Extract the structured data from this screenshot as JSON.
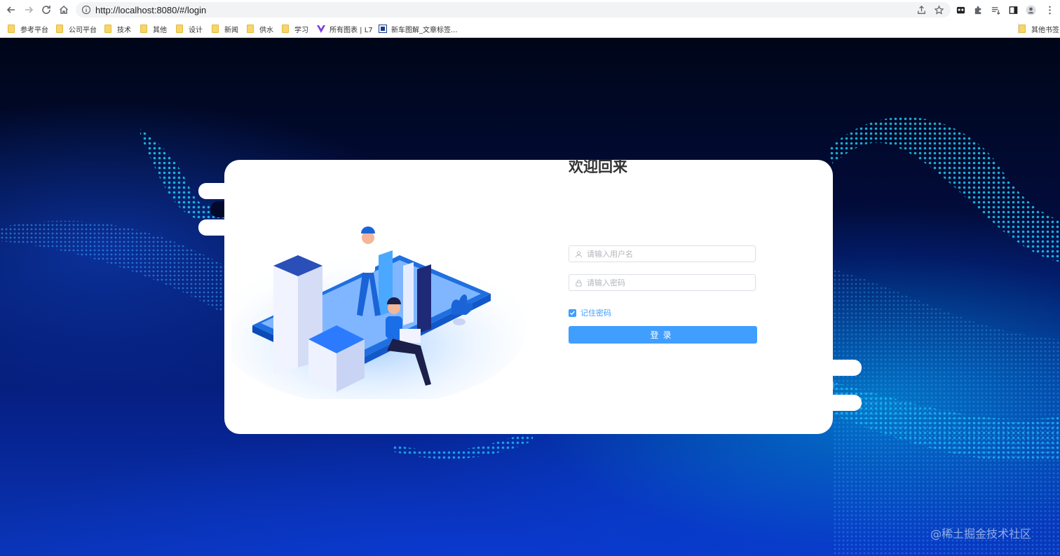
{
  "browser": {
    "url": "http://localhost:8080/#/login"
  },
  "bookmarks": [
    {
      "label": "参考平台",
      "icon": "folder-icon"
    },
    {
      "label": "公司平台",
      "icon": "folder-icon"
    },
    {
      "label": "技术",
      "icon": "folder-icon"
    },
    {
      "label": "其他",
      "icon": "folder-icon"
    },
    {
      "label": "设计",
      "icon": "folder-icon"
    },
    {
      "label": "新闻",
      "icon": "folder-icon"
    },
    {
      "label": "供水",
      "icon": "folder-icon"
    },
    {
      "label": "学习",
      "icon": "folder-icon"
    },
    {
      "label": "所有图表 | L7",
      "icon": "vue-logo-icon"
    },
    {
      "label": "新车图解_文章标签...",
      "icon": "site-favicon-icon"
    }
  ],
  "other_bookmarks": "其他书签",
  "login": {
    "title": "欢迎回来",
    "username_placeholder": "请输入用户名",
    "password_placeholder": "请输入密码",
    "remember_label": "记住密码",
    "remember_checked": true,
    "submit_label": "登录"
  },
  "watermark": "@稀土掘金技术社区",
  "colors": {
    "accent": "#409eff",
    "title": "#333333",
    "background_dark": "#020c3c",
    "background_glow": "#00beff"
  }
}
